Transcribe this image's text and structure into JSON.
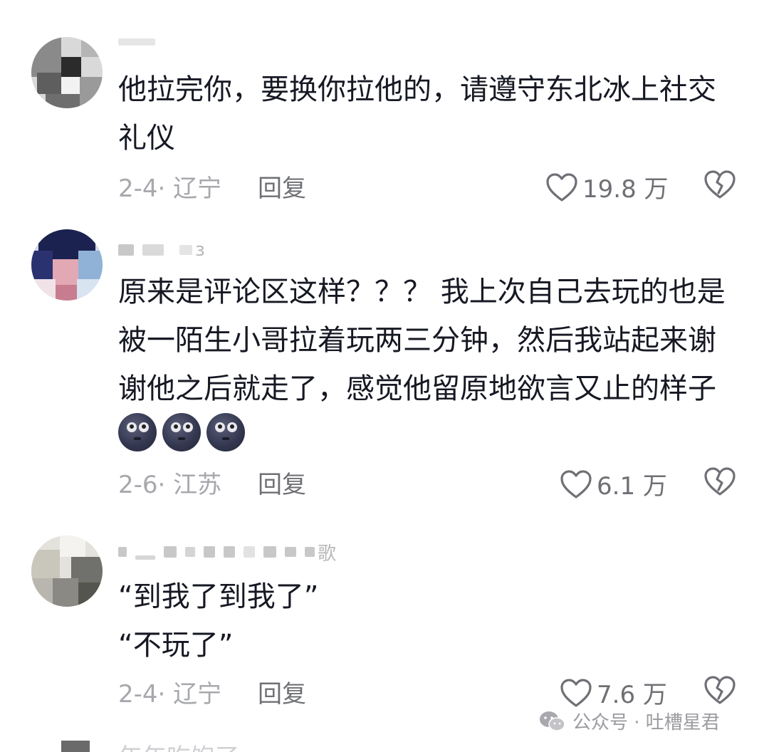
{
  "comments": [
    {
      "text": "他拉完你，要换你拉他的，请遵守东北冰上社交礼仪",
      "date_location": "2-4· 辽宁",
      "reply_label": "回复",
      "like_count": "19.8 万"
    },
    {
      "text": "原来是评论区这样？？？ 我上次自己去玩的也是被一陌生小哥拉着玩两三分钟，然后我站起来谢谢他之后就走了，感觉他留原地欲言又止的样子",
      "username_tail": "ɜ",
      "emojis": [
        "emoji-face",
        "emoji-face",
        "emoji-face"
      ],
      "date_location": "2-6· 江苏",
      "reply_label": "回复",
      "like_count": "6.1 万"
    },
    {
      "line1": "“到我了到我了”",
      "line2": "“不玩了”",
      "username_tail": "歌",
      "date_location": "2-4· 辽宁",
      "reply_label": "回复",
      "like_count": "7.6 万"
    }
  ],
  "watermark": "公众号 · 吐槽星君",
  "cut_off_text": "年年吃饱了",
  "colors": {
    "text": "#161823",
    "meta": "#a7a8ad",
    "reply": "#6f7075",
    "icon": "#6f7075"
  },
  "icons": {
    "like": "heart-outline-icon",
    "dislike": "broken-heart-icon",
    "watermark": "wechat-icon"
  }
}
